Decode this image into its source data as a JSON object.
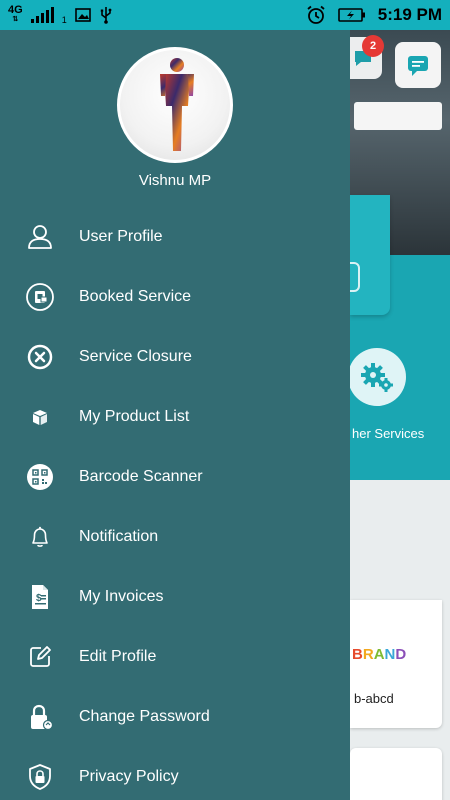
{
  "status_bar": {
    "network": "4G",
    "sim_slot": "1",
    "time": "5:19 PM"
  },
  "drawer": {
    "user_name": "Vishnu MP",
    "menu_items": [
      {
        "label": "User Profile",
        "icon": "user-icon"
      },
      {
        "label": "Booked Service",
        "icon": "booked-service-icon"
      },
      {
        "label": "Service Closure",
        "icon": "close-circle-icon"
      },
      {
        "label": "My Product List",
        "icon": "box-icon"
      },
      {
        "label": "Barcode Scanner",
        "icon": "qr-code-icon"
      },
      {
        "label": "Notification",
        "icon": "bell-icon"
      },
      {
        "label": "My Invoices",
        "icon": "invoice-icon"
      },
      {
        "label": "Edit Profile",
        "icon": "edit-icon"
      },
      {
        "label": "Change Password",
        "icon": "lock-icon"
      },
      {
        "label": "Privacy Policy",
        "icon": "shield-lock-icon"
      }
    ]
  },
  "background": {
    "notification_count": "2",
    "services_label": "her Services",
    "brand_text": "BRAND",
    "product_name": "b-abcd"
  },
  "colors": {
    "status_bar": "#14b0bd",
    "drawer": "#336c73",
    "accent_teal": "#1aa6b2"
  }
}
